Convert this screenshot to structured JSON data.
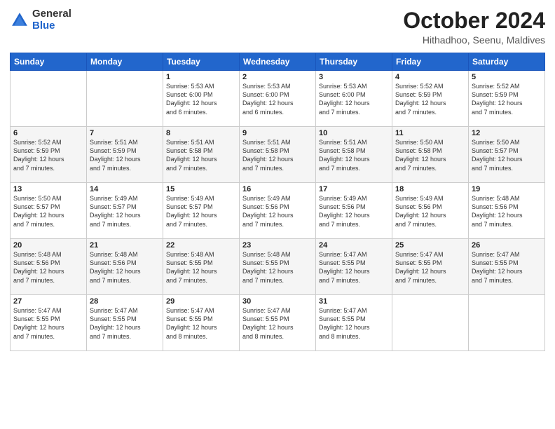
{
  "logo": {
    "general": "General",
    "blue": "Blue"
  },
  "header": {
    "month": "October 2024",
    "location": "Hithadhoo, Seenu, Maldives"
  },
  "weekdays": [
    "Sunday",
    "Monday",
    "Tuesday",
    "Wednesday",
    "Thursday",
    "Friday",
    "Saturday"
  ],
  "weeks": [
    [
      {
        "day": "",
        "info": ""
      },
      {
        "day": "",
        "info": ""
      },
      {
        "day": "1",
        "info": "Sunrise: 5:53 AM\nSunset: 6:00 PM\nDaylight: 12 hours\nand 6 minutes."
      },
      {
        "day": "2",
        "info": "Sunrise: 5:53 AM\nSunset: 6:00 PM\nDaylight: 12 hours\nand 6 minutes."
      },
      {
        "day": "3",
        "info": "Sunrise: 5:53 AM\nSunset: 6:00 PM\nDaylight: 12 hours\nand 7 minutes."
      },
      {
        "day": "4",
        "info": "Sunrise: 5:52 AM\nSunset: 5:59 PM\nDaylight: 12 hours\nand 7 minutes."
      },
      {
        "day": "5",
        "info": "Sunrise: 5:52 AM\nSunset: 5:59 PM\nDaylight: 12 hours\nand 7 minutes."
      }
    ],
    [
      {
        "day": "6",
        "info": "Sunrise: 5:52 AM\nSunset: 5:59 PM\nDaylight: 12 hours\nand 7 minutes."
      },
      {
        "day": "7",
        "info": "Sunrise: 5:51 AM\nSunset: 5:59 PM\nDaylight: 12 hours\nand 7 minutes."
      },
      {
        "day": "8",
        "info": "Sunrise: 5:51 AM\nSunset: 5:58 PM\nDaylight: 12 hours\nand 7 minutes."
      },
      {
        "day": "9",
        "info": "Sunrise: 5:51 AM\nSunset: 5:58 PM\nDaylight: 12 hours\nand 7 minutes."
      },
      {
        "day": "10",
        "info": "Sunrise: 5:51 AM\nSunset: 5:58 PM\nDaylight: 12 hours\nand 7 minutes."
      },
      {
        "day": "11",
        "info": "Sunrise: 5:50 AM\nSunset: 5:58 PM\nDaylight: 12 hours\nand 7 minutes."
      },
      {
        "day": "12",
        "info": "Sunrise: 5:50 AM\nSunset: 5:57 PM\nDaylight: 12 hours\nand 7 minutes."
      }
    ],
    [
      {
        "day": "13",
        "info": "Sunrise: 5:50 AM\nSunset: 5:57 PM\nDaylight: 12 hours\nand 7 minutes."
      },
      {
        "day": "14",
        "info": "Sunrise: 5:49 AM\nSunset: 5:57 PM\nDaylight: 12 hours\nand 7 minutes."
      },
      {
        "day": "15",
        "info": "Sunrise: 5:49 AM\nSunset: 5:57 PM\nDaylight: 12 hours\nand 7 minutes."
      },
      {
        "day": "16",
        "info": "Sunrise: 5:49 AM\nSunset: 5:56 PM\nDaylight: 12 hours\nand 7 minutes."
      },
      {
        "day": "17",
        "info": "Sunrise: 5:49 AM\nSunset: 5:56 PM\nDaylight: 12 hours\nand 7 minutes."
      },
      {
        "day": "18",
        "info": "Sunrise: 5:49 AM\nSunset: 5:56 PM\nDaylight: 12 hours\nand 7 minutes."
      },
      {
        "day": "19",
        "info": "Sunrise: 5:48 AM\nSunset: 5:56 PM\nDaylight: 12 hours\nand 7 minutes."
      }
    ],
    [
      {
        "day": "20",
        "info": "Sunrise: 5:48 AM\nSunset: 5:56 PM\nDaylight: 12 hours\nand 7 minutes."
      },
      {
        "day": "21",
        "info": "Sunrise: 5:48 AM\nSunset: 5:56 PM\nDaylight: 12 hours\nand 7 minutes."
      },
      {
        "day": "22",
        "info": "Sunrise: 5:48 AM\nSunset: 5:55 PM\nDaylight: 12 hours\nand 7 minutes."
      },
      {
        "day": "23",
        "info": "Sunrise: 5:48 AM\nSunset: 5:55 PM\nDaylight: 12 hours\nand 7 minutes."
      },
      {
        "day": "24",
        "info": "Sunrise: 5:47 AM\nSunset: 5:55 PM\nDaylight: 12 hours\nand 7 minutes."
      },
      {
        "day": "25",
        "info": "Sunrise: 5:47 AM\nSunset: 5:55 PM\nDaylight: 12 hours\nand 7 minutes."
      },
      {
        "day": "26",
        "info": "Sunrise: 5:47 AM\nSunset: 5:55 PM\nDaylight: 12 hours\nand 7 minutes."
      }
    ],
    [
      {
        "day": "27",
        "info": "Sunrise: 5:47 AM\nSunset: 5:55 PM\nDaylight: 12 hours\nand 7 minutes."
      },
      {
        "day": "28",
        "info": "Sunrise: 5:47 AM\nSunset: 5:55 PM\nDaylight: 12 hours\nand 7 minutes."
      },
      {
        "day": "29",
        "info": "Sunrise: 5:47 AM\nSunset: 5:55 PM\nDaylight: 12 hours\nand 8 minutes."
      },
      {
        "day": "30",
        "info": "Sunrise: 5:47 AM\nSunset: 5:55 PM\nDaylight: 12 hours\nand 8 minutes."
      },
      {
        "day": "31",
        "info": "Sunrise: 5:47 AM\nSunset: 5:55 PM\nDaylight: 12 hours\nand 8 minutes."
      },
      {
        "day": "",
        "info": ""
      },
      {
        "day": "",
        "info": ""
      }
    ]
  ]
}
